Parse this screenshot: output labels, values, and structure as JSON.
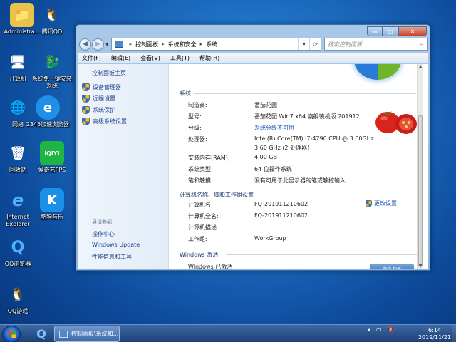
{
  "desktop": {
    "icons": [
      {
        "label": "Administra...",
        "glyph": "📁",
        "bg": "#e8c24a"
      },
      {
        "label": "腾讯QQ",
        "glyph": "🐧",
        "bg": "transparent"
      },
      {
        "label": "计算机",
        "glyph": "🖥",
        "bg": "transparent"
      },
      {
        "label": "系统免一键安装系统",
        "glyph": "🐉",
        "bg": "transparent"
      },
      {
        "label": "网络",
        "glyph": "🌐",
        "bg": "transparent"
      },
      {
        "label": "2345加速浏览器",
        "glyph": "e",
        "bg": "#1f8fe8"
      },
      {
        "label": "回收站",
        "glyph": "🗑",
        "bg": "transparent"
      },
      {
        "label": "爱奇艺PPS",
        "glyph": "iQIYI",
        "bg": "#1fb545"
      },
      {
        "label": "Internet Explorer",
        "glyph": "e",
        "bg": "transparent"
      },
      {
        "label": "酷狗音乐",
        "glyph": "K",
        "bg": "#1c8fe6"
      },
      {
        "label": "QQ浏览器",
        "glyph": "Q",
        "bg": "transparent"
      },
      {
        "label": "QQ游戏",
        "glyph": "🐧",
        "bg": "transparent"
      }
    ]
  },
  "window": {
    "caption": {
      "minimize": "—",
      "maximize": "□",
      "close": "✕"
    },
    "address": {
      "crumbs": [
        "控制面板",
        "系统和安全",
        "系统"
      ],
      "search_placeholder": "搜索控制面板"
    },
    "menu": [
      "文件(F)",
      "编辑(E)",
      "查看(V)",
      "工具(T)",
      "帮助(H)"
    ],
    "left_pane": {
      "home": "控制面板主页",
      "items": [
        "设备管理器",
        "远程设置",
        "系统保护",
        "高级系统设置"
      ],
      "see_also_title": "另请参阅",
      "see_also": [
        "操作中心",
        "Windows Update",
        "性能信息和工具"
      ]
    },
    "system": {
      "section_title": "系统",
      "rows": [
        {
          "label": "制造商:",
          "value": "番茄花园"
        },
        {
          "label": "型号:",
          "value": "番茄花园 Win7 x64 旗舰装机版 201912"
        },
        {
          "label": "分级:",
          "value": "系统分级不可用"
        },
        {
          "label": "处理器:",
          "value": "Intel(R) Core(TM) i7-4790 CPU @ 3.60GHz"
        },
        {
          "label": "",
          "value": "3.60 GHz  (2 处理器)"
        },
        {
          "label": "安装内存(RAM):",
          "value": "4.00 GB"
        },
        {
          "label": "系统类型:",
          "value": "64 位操作系统"
        },
        {
          "label": "笔和触摸:",
          "value": "没有可用于此显示器的笔或触控输入"
        }
      ]
    },
    "computer": {
      "section_title": "计算机名称、域和工作组设置",
      "change_settings": "更改设置",
      "rows": [
        {
          "label": "计算机名:",
          "value": "FQ-201911210602"
        },
        {
          "label": "计算机全名:",
          "value": "FQ-201911210602"
        },
        {
          "label": "计算机描述:",
          "value": ""
        },
        {
          "label": "工作组:",
          "value": "WorkGroup"
        }
      ]
    },
    "activation": {
      "section_title": "Windows 激活",
      "status": "Windows 已激活",
      "badge": "微软 软件"
    }
  },
  "taskbar": {
    "task_label": "控制面板\\系统和...",
    "clock_time": "6:14",
    "clock_date": "2019/11/21"
  },
  "colors": {
    "accent": "#1a56b8",
    "link": "#1a3e8c"
  }
}
